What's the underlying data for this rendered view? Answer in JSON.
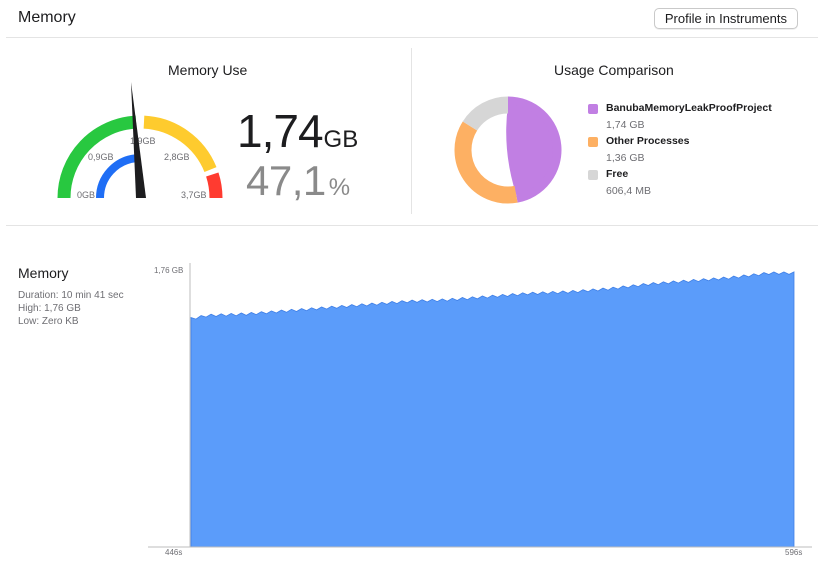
{
  "header": {
    "title": "Memory",
    "profile_button": "Profile in Instruments"
  },
  "memory_use": {
    "title": "Memory Use",
    "value": "1,74",
    "unit": "GB",
    "percent": "47,1",
    "percent_sign": "%",
    "gauge_level_gb": 1.74,
    "gauge_max_gb": 3.7,
    "gauge_labels": [
      "0GB",
      "0,9GB",
      "1,9GB",
      "2,8GB",
      "3,7GB"
    ],
    "colors": {
      "green": "#28c840",
      "blue": "#1f6ef5",
      "yellow": "#fecb2e",
      "red": "#ff3b30",
      "needle": "#1d1d1f"
    }
  },
  "usage_comparison": {
    "title": "Usage Comparison",
    "items": [
      {
        "name": "BanubaMemoryLeakProofProject",
        "value": "1,74 GB",
        "color": "#c17fe3"
      },
      {
        "name": "Other Processes",
        "value": "1,36 GB",
        "color": "#fdb063"
      },
      {
        "name": "Free",
        "value": "606,4 MB",
        "color": "#d6d6d6"
      }
    ]
  },
  "memory_chart_panel": {
    "title": "Memory",
    "duration": "Duration: 10 min 41 sec",
    "high": "High: 1,76 GB",
    "low": "Low: Zero KB"
  },
  "chart_data": {
    "type": "area",
    "x_start_label": "446s",
    "x_end_label": "596s",
    "y_max_label": "1,76 GB",
    "xlim": [
      446,
      596
    ],
    "ylim": [
      0,
      1.76
    ],
    "series": [
      {
        "color": "#5b9cfa",
        "x": [
          446,
          450,
          460,
          470,
          480,
          490,
          500,
          510,
          520,
          530,
          540,
          550,
          560,
          570,
          580,
          590,
          596
        ],
        "values": [
          1.45,
          1.47,
          1.48,
          1.5,
          1.52,
          1.54,
          1.56,
          1.57,
          1.59,
          1.61,
          1.62,
          1.64,
          1.67,
          1.69,
          1.71,
          1.74,
          1.74
        ]
      }
    ]
  }
}
